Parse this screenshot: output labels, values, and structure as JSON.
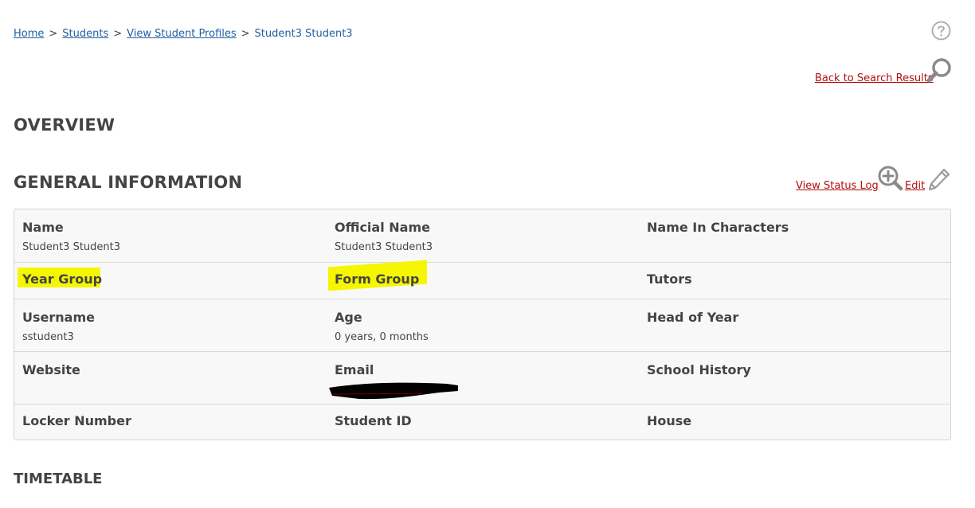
{
  "breadcrumb": {
    "items": [
      "Home",
      "Students",
      "View Student Profiles"
    ],
    "separator": ">",
    "current": "Student3 Student3"
  },
  "header": {
    "back_link": "Back to Search Results"
  },
  "overview": {
    "title": "OVERVIEW"
  },
  "general": {
    "title": "GENERAL INFORMATION",
    "status_log_link": "View Status Log",
    "edit_link": "Edit",
    "rows": [
      [
        {
          "label": "Name",
          "value": "Student3 Student3"
        },
        {
          "label": "Official Name",
          "value": "Student3 Student3"
        },
        {
          "label": "Name In Characters",
          "value": ""
        }
      ],
      [
        {
          "label": "Year Group",
          "value": ""
        },
        {
          "label": "Form Group",
          "value": ""
        },
        {
          "label": "Tutors",
          "value": ""
        }
      ],
      [
        {
          "label": "Username",
          "value": "sstudent3"
        },
        {
          "label": "Age",
          "value": "0 years, 0 months"
        },
        {
          "label": "Head of Year",
          "value": ""
        }
      ],
      [
        {
          "label": "Website",
          "value": ""
        },
        {
          "label": "Email",
          "value": ""
        },
        {
          "label": "School History",
          "value": ""
        }
      ],
      [
        {
          "label": "Locker Number",
          "value": ""
        },
        {
          "label": "Student ID",
          "value": ""
        },
        {
          "label": "House",
          "value": ""
        }
      ]
    ]
  },
  "timetable": {
    "title": "TIMETABLE"
  },
  "icons": {
    "help": "help-icon",
    "search": "search-icon",
    "zoom": "zoom-in-icon",
    "edit": "pencil-icon"
  },
  "colors": {
    "link": "#1f5fa3",
    "action_link": "#b30d0d",
    "highlight": "#f4f700",
    "heading": "#444444"
  }
}
